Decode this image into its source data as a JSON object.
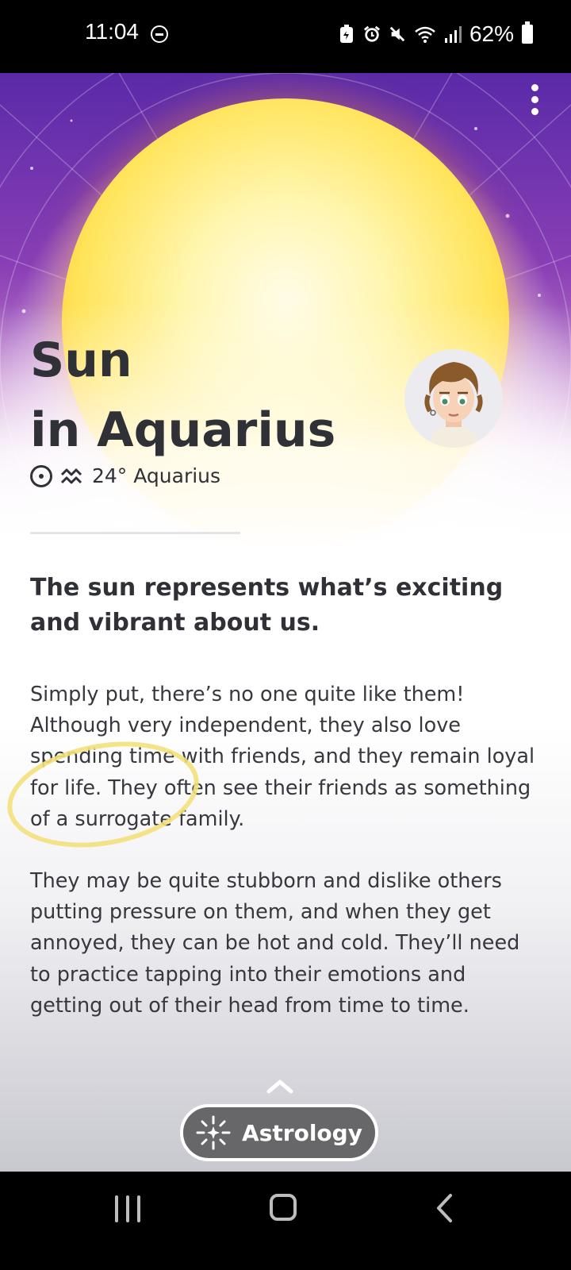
{
  "status_bar": {
    "time": "11:04",
    "battery": "62%",
    "icons": [
      "dnd-icon",
      "battery-saver-icon",
      "alarm-icon",
      "mute-icon",
      "wifi-icon",
      "signal-icon",
      "battery-icon"
    ]
  },
  "header": {
    "menu_icon": "more-vert-icon"
  },
  "hero": {
    "title_line1": "Sun",
    "title_line2": "in Aquarius",
    "position_text": "24° Aquarius",
    "colors": {
      "sky_top": "#5a2aa8",
      "sun_core": "#ffe45a",
      "sun_edge": "#ff7f2a"
    }
  },
  "content": {
    "lead": "The sun represents what’s exciting and vibrant about us.",
    "paragraph1": "Simply put, there’s no one quite like them! Although very independent, they also love spending time with friends, and they remain loyal for life. They often see their friends as something of a surrogate family.",
    "paragraph2": "They may be quite stubborn and dislike others putting pressure on them, and when they get annoyed, they can be hot and cold. They’ll need to practice tapping into their emotions and getting out of their head from time to time.",
    "highlight_color": "#f4e07a"
  },
  "bottom": {
    "button_label": "Astrology"
  },
  "navbar": {
    "icons": [
      "recents-icon",
      "home-icon",
      "back-icon"
    ]
  }
}
